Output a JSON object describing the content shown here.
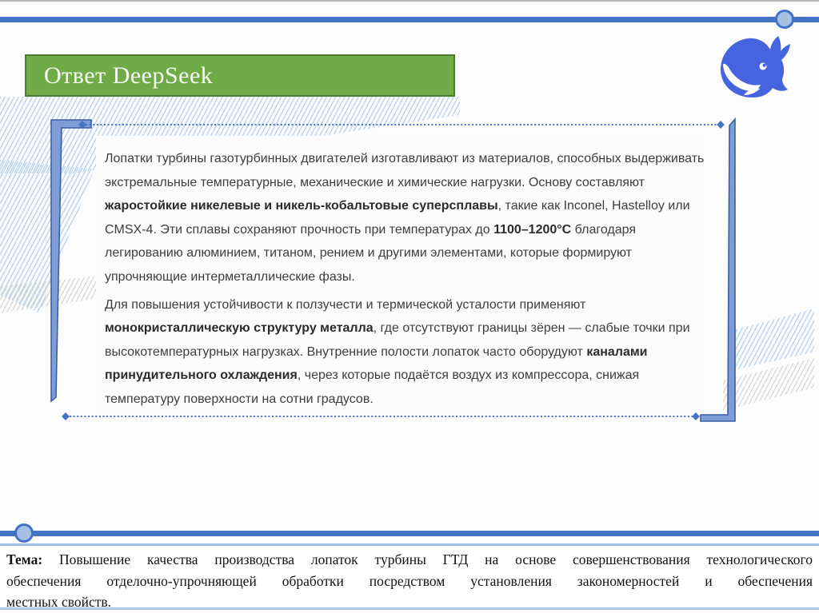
{
  "header": {
    "title": "Ответ DeepSeek"
  },
  "logo": {
    "icon": "deepseek-whale-icon"
  },
  "colors": {
    "accent": "#4472C4",
    "circle_fill": "#A6C0E3",
    "green": "#6FAC47",
    "green_border": "#4E7A31",
    "bracket": "#7F9DD4",
    "light_blue": "#9CC3E5",
    "whale": "#4664E0"
  },
  "answer": {
    "lines": [
      {
        "para": 0,
        "segments": [
          {
            "text": "Лопатки турбины газотурбинных двигателей изготавливают из материалов, способных выдерживать",
            "bold": false
          }
        ]
      },
      {
        "para": 0,
        "segments": [
          {
            "text": "экстремальные температурные, механические и химические нагрузки. Основу составляют",
            "bold": false
          }
        ]
      },
      {
        "para": 0,
        "segments": [
          {
            "text": "жаростойкие никелевые и никель-кобальтовые суперсплавы",
            "bold": true
          },
          {
            "text": ", такие как Inconel, Hastelloy или",
            "bold": false
          }
        ]
      },
      {
        "para": 0,
        "segments": [
          {
            "text": "CMSX-4. Эти сплавы сохраняют прочность при температурах до ",
            "bold": false
          },
          {
            "text": "1100–1200°C",
            "bold": true
          },
          {
            "text": " благодаря",
            "bold": false
          }
        ]
      },
      {
        "para": 0,
        "segments": [
          {
            "text": "легированию алюминием, титаном, рением и другими элементами, которые формируют",
            "bold": false
          }
        ]
      },
      {
        "para": 0,
        "segments": [
          {
            "text": "упрочняющие интерметаллические фазы.",
            "bold": false
          }
        ]
      },
      {
        "para": 1,
        "segments": [
          {
            "text": "Для повышения устойчивости к ползучести и термической усталости применяют",
            "bold": false
          }
        ]
      },
      {
        "para": 1,
        "segments": [
          {
            "text": "монокристаллическую структуру металла",
            "bold": true
          },
          {
            "text": ", где отсутствуют границы зёрен — слабые точки при",
            "bold": false
          }
        ]
      },
      {
        "para": 1,
        "segments": [
          {
            "text": "высокотемпературных нагрузках. Внутренние полости лопаток часто оборудуют ",
            "bold": false
          },
          {
            "text": "каналами",
            "bold": true
          }
        ]
      },
      {
        "para": 1,
        "segments": [
          {
            "text": "принудительного охлаждения",
            "bold": true
          },
          {
            "text": ", через которые подаётся воздух из компрессора, снижая",
            "bold": false
          }
        ]
      },
      {
        "para": 1,
        "segments": [
          {
            "text": "температуру поверхности на сотни градусов.",
            "bold": false
          }
        ]
      }
    ]
  },
  "footer": {
    "lines": [
      {
        "justify": true,
        "segments": [
          {
            "text": "Тема: ",
            "bold": true
          },
          {
            "text": "Повышение качества производства лопаток турбины ГТД на основе совершенствования технологического",
            "bold": false
          }
        ]
      },
      {
        "justify": true,
        "segments": [
          {
            "text": "обеспечения отделочно-упрочняющей обработки посредством установления закономерностей и обеспечения",
            "bold": false
          }
        ]
      },
      {
        "justify": false,
        "segments": [
          {
            "text": "местных свойств.",
            "bold": false
          }
        ]
      }
    ]
  }
}
